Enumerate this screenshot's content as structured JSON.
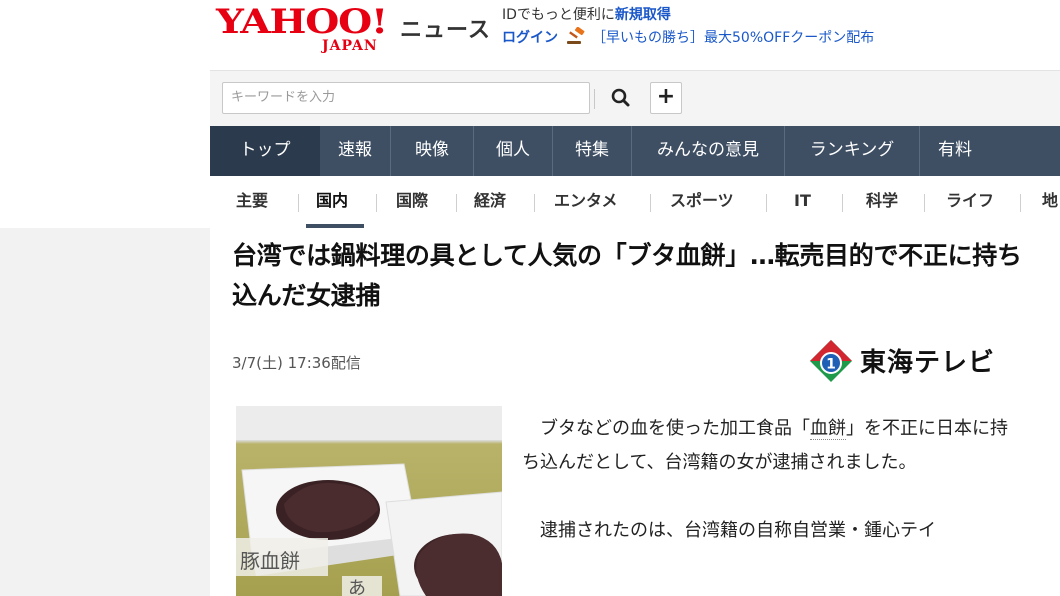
{
  "header": {
    "logo_text": "YAHOO!",
    "logo_sub": "JAPAN",
    "section_title": "ニュース",
    "promo_line1_prefix": "IDでもっと便利に",
    "promo_line1_link": "新規取得",
    "login_label": "ログイン",
    "promo_line2": "［早いもの勝ち］最大50%OFFクーポン配布"
  },
  "search": {
    "placeholder": "キーワードを入力"
  },
  "primary_nav": [
    "トップ",
    "速報",
    "映像",
    "個人",
    "特集",
    "みんなの意見",
    "ランキング",
    "有料"
  ],
  "secondary_nav": [
    "主要",
    "国内",
    "国際",
    "経済",
    "エンタメ",
    "スポーツ",
    "IT",
    "科学",
    "ライフ",
    "地域"
  ],
  "secondary_nav_active": "国内",
  "article": {
    "headline": "台湾では鍋料理の具として人気の「ブタ血餅」…転売目的で不正に持ち込んだ女逮捕",
    "date": "3/7(土) 17:36配信",
    "source": "東海テレビ",
    "photo_label_1": "豚血餅",
    "photo_label_2": "あ",
    "paragraph1_pre": "ブタなどの血を使った加工食品「",
    "paragraph1_term": "血餅",
    "paragraph1_post": "」を不正に日本に持ち込んだとして、台湾籍の女が逮捕されました。",
    "paragraph2": "逮捕されたのは、台湾籍の自称自営業・鍾心テイ"
  },
  "colors": {
    "brand_red": "#e60012",
    "nav_bg": "#3e4e63",
    "link_blue": "#1a58c9"
  }
}
